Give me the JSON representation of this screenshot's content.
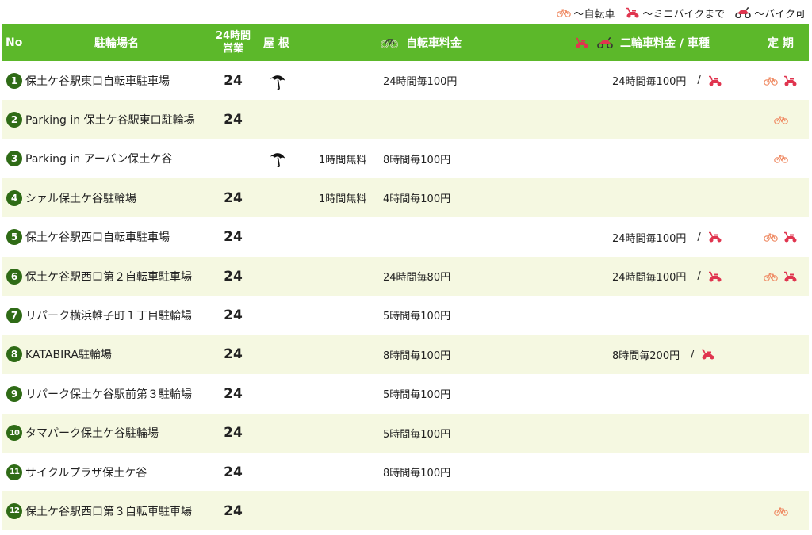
{
  "legend": {
    "bicycle": "〜自転車",
    "minibike": "〜ミニバイクまで",
    "motorbike": "〜バイク可"
  },
  "header": {
    "no": "No",
    "name": "駐輪場名",
    "hours_line1": "24時間",
    "hours_line2": "営業",
    "roof": "屋 根",
    "bicycle_fee": "自転車料金",
    "moto_fee": "二輪車料金 / 車種",
    "pass": "定 期"
  },
  "colors": {
    "header_bg": "#5cb82a",
    "alt_row_bg": "#f5f8e1",
    "number_badge": "#2f6b16",
    "bike_icon": "#ef8a63",
    "bike_icon_green": "#6aa832",
    "scooter_icon": "#e0354f"
  },
  "rows": [
    {
      "no": "1",
      "name": "保土ケ谷駅東口自転車駐車場",
      "hours": "24",
      "roof": true,
      "free": "",
      "bike_fee": "24時間毎100円",
      "moto_fee": "24時間毎100円",
      "moto_sep": "/",
      "moto_type": "minibike",
      "pass": [
        "bicycle",
        "minibike"
      ]
    },
    {
      "no": "2",
      "name": "Parking in 保土ケ谷駅東口駐輪場",
      "hours": "24",
      "roof": false,
      "free": "",
      "bike_fee": "",
      "moto_fee": "",
      "moto_sep": "",
      "moto_type": "",
      "pass": [
        "bicycle"
      ]
    },
    {
      "no": "3",
      "name": "Parking in アーバン保土ケ谷",
      "hours": "",
      "roof": true,
      "free": "1時間無料",
      "bike_fee": "8時間毎100円",
      "moto_fee": "",
      "moto_sep": "",
      "moto_type": "",
      "pass": [
        "bicycle"
      ]
    },
    {
      "no": "4",
      "name": "シァル保土ケ谷駐輪場",
      "hours": "24",
      "roof": false,
      "free": "1時間無料",
      "bike_fee": "4時間毎100円",
      "moto_fee": "",
      "moto_sep": "",
      "moto_type": "",
      "pass": []
    },
    {
      "no": "5",
      "name": "保土ケ谷駅西口自転車駐車場",
      "hours": "24",
      "roof": false,
      "free": "",
      "bike_fee": "",
      "moto_fee": "24時間毎100円",
      "moto_sep": "/",
      "moto_type": "minibike",
      "pass": [
        "bicycle",
        "minibike"
      ]
    },
    {
      "no": "6",
      "name": "保土ケ谷駅西口第２自転車駐車場",
      "hours": "24",
      "roof": false,
      "free": "",
      "bike_fee": "24時間毎80円",
      "moto_fee": "24時間毎100円",
      "moto_sep": "/",
      "moto_type": "minibike",
      "pass": [
        "bicycle",
        "minibike"
      ]
    },
    {
      "no": "7",
      "name": "リパーク横浜帷子町１丁目駐輪場",
      "hours": "24",
      "roof": false,
      "free": "",
      "bike_fee": "5時間毎100円",
      "moto_fee": "",
      "moto_sep": "",
      "moto_type": "",
      "pass": []
    },
    {
      "no": "8",
      "name": "KATABIRA駐輪場",
      "hours": "24",
      "roof": false,
      "free": "",
      "bike_fee": "8時間毎100円",
      "moto_fee": "8時間毎200円",
      "moto_sep": "/",
      "moto_type": "minibike",
      "pass": []
    },
    {
      "no": "9",
      "name": "リパーク保土ケ谷駅前第３駐輪場",
      "hours": "24",
      "roof": false,
      "free": "",
      "bike_fee": "5時間毎100円",
      "moto_fee": "",
      "moto_sep": "",
      "moto_type": "",
      "pass": []
    },
    {
      "no": "10",
      "name": "タマパーク保土ケ谷駐輪場",
      "hours": "24",
      "roof": false,
      "free": "",
      "bike_fee": "5時間毎100円",
      "moto_fee": "",
      "moto_sep": "",
      "moto_type": "",
      "pass": []
    },
    {
      "no": "11",
      "name": "サイクルプラザ保土ケ谷",
      "hours": "24",
      "roof": false,
      "free": "",
      "bike_fee": "8時間毎100円",
      "moto_fee": "",
      "moto_sep": "",
      "moto_type": "",
      "pass": []
    },
    {
      "no": "12",
      "name": "保土ケ谷駅西口第３自転車駐車場",
      "hours": "24",
      "roof": false,
      "free": "",
      "bike_fee": "",
      "moto_fee": "",
      "moto_sep": "",
      "moto_type": "",
      "pass": [
        "bicycle"
      ]
    }
  ]
}
